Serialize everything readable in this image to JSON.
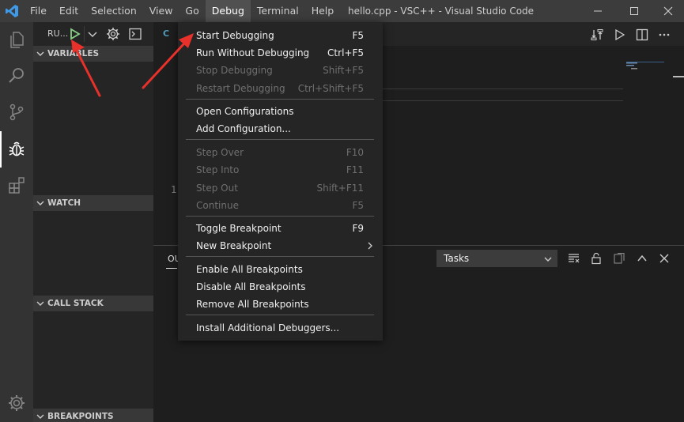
{
  "titlebar": {
    "menu": [
      "File",
      "Edit",
      "Selection",
      "View",
      "Go",
      "Debug",
      "Terminal",
      "Help"
    ],
    "active_menu": "Debug",
    "window_title": "hello.cpp - VSC++ - Visual Studio Code"
  },
  "sidebar": {
    "debug_label": "RU...",
    "sections": {
      "variables": "VARIABLES",
      "watch": "WATCH",
      "call_stack": "CALL STACK",
      "breakpoints": "BREAKPOINTS"
    }
  },
  "editor": {
    "tab_icon": "C",
    "line_number": "1"
  },
  "panel": {
    "tab_label": "OU",
    "tasks_select": "Tasks"
  },
  "debug_menu": {
    "items": [
      {
        "label": "Start Debugging",
        "shortcut": "F5"
      },
      {
        "label": "Run Without Debugging",
        "shortcut": "Ctrl+F5"
      },
      {
        "label": "Stop Debugging",
        "shortcut": "Shift+F5"
      },
      {
        "label": "Restart Debugging",
        "shortcut": "Ctrl+Shift+F5"
      },
      {
        "label": "Open Configurations",
        "shortcut": ""
      },
      {
        "label": "Add Configuration...",
        "shortcut": ""
      },
      {
        "label": "Step Over",
        "shortcut": "F10"
      },
      {
        "label": "Step Into",
        "shortcut": "F11"
      },
      {
        "label": "Step Out",
        "shortcut": "Shift+F11"
      },
      {
        "label": "Continue",
        "shortcut": "F5"
      },
      {
        "label": "Toggle Breakpoint",
        "shortcut": "F9"
      },
      {
        "label": "New Breakpoint",
        "shortcut": ""
      },
      {
        "label": "Enable All Breakpoints",
        "shortcut": ""
      },
      {
        "label": "Disable All Breakpoints",
        "shortcut": ""
      },
      {
        "label": "Remove All Breakpoints",
        "shortcut": ""
      },
      {
        "label": "Install Additional Debuggers...",
        "shortcut": ""
      }
    ]
  },
  "colors": {
    "accent_play": "#89d185",
    "annotation_arrow": "#e8312a",
    "vscode_blue": "#3e9be9"
  }
}
